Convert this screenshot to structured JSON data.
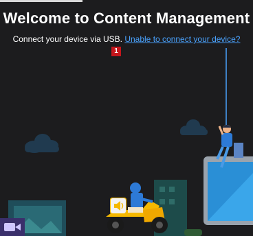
{
  "page": {
    "title": "Welcome to Content Management",
    "instruction": "Connect your device via USB.",
    "help_link": "Unable to connect your device?",
    "badge": "1"
  },
  "colors": {
    "background": "#1c1c1e",
    "link": "#4aa3ff",
    "badge": "#c4161c",
    "scooter": "#f5b800",
    "tablet_screen": "#2a8fd6"
  },
  "icons": [
    "speaker-icon",
    "video-icon"
  ]
}
